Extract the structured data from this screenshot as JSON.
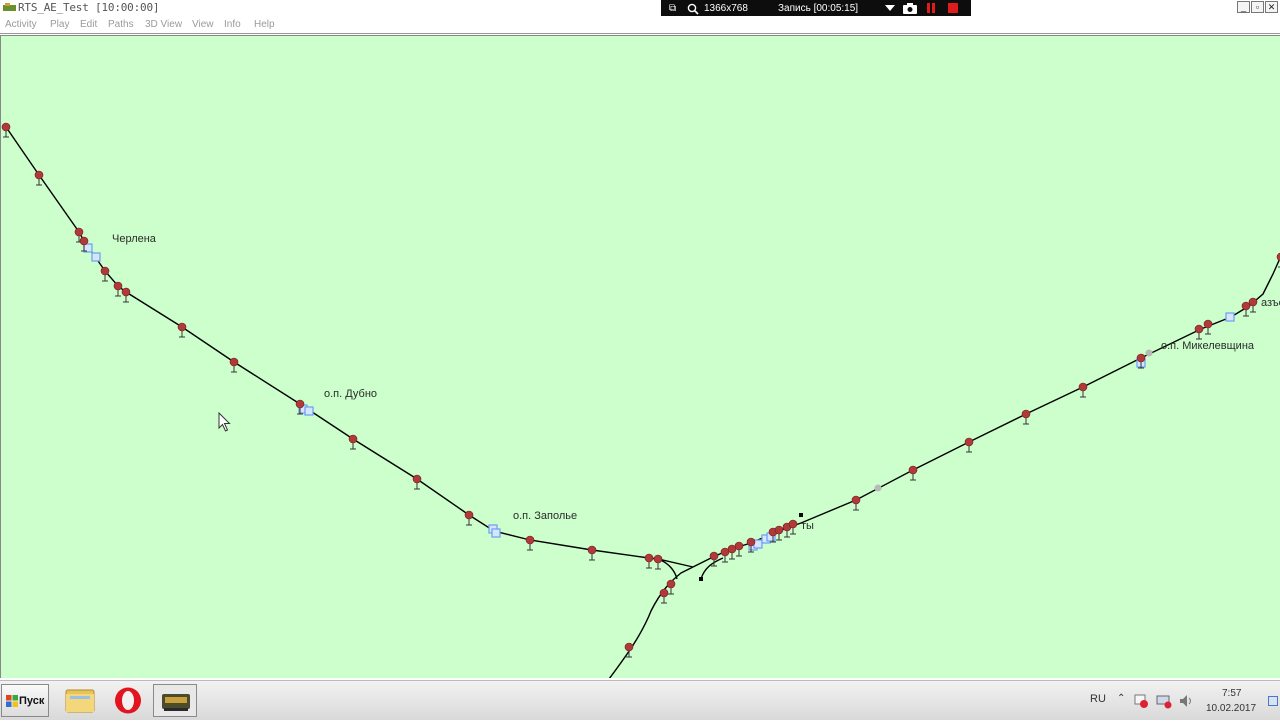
{
  "window": {
    "title": "RTS_AE_Test [10:00:00]"
  },
  "recorder": {
    "resolution": "1366x768",
    "status": "Запись [00:05:15]"
  },
  "menu": [
    "Activity",
    "Play",
    "Edit",
    "Paths",
    "3D View",
    "View",
    "Info",
    "Help"
  ],
  "map": {
    "stations": [
      {
        "name": "Черлена"
      },
      {
        "name": "о.п. Дубно"
      },
      {
        "name": "о.п. Заполье"
      },
      {
        "name": "ты"
      },
      {
        "name": "о.п. Микелевщина"
      },
      {
        "name": "азъе"
      }
    ]
  },
  "taskbar": {
    "start_label": "Пуск",
    "lang": "RU",
    "time": "7:57",
    "date": "10.02.2017"
  },
  "colors": {
    "map_background": "#ccffcc",
    "track": "#000000",
    "signal": "#b03a3a",
    "platform_marker": "#6a9ef0"
  }
}
